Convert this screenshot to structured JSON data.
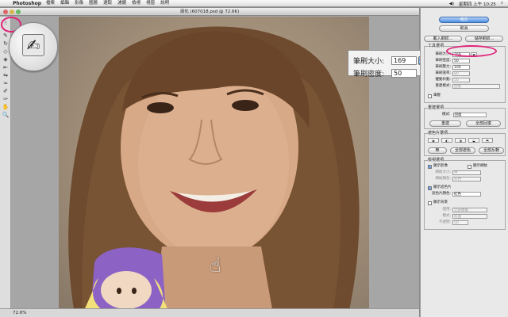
{
  "menubar": {
    "app": "Photoshop",
    "items": [
      "檔案",
      "編輯",
      "影像",
      "圖層",
      "選取",
      "濾鏡",
      "檢視",
      "視窗",
      "說明"
    ],
    "clock": "星期四 上午 10:25"
  },
  "document": {
    "title": "液化 (607018.psd @ 72.6K)",
    "zoom": "72.6%"
  },
  "hud": {
    "brush_size_label": "筆刷大小:",
    "brush_size_value": "169",
    "brush_density_label": "筆刷密度:",
    "brush_density_value": "50"
  },
  "panel": {
    "ok": "確定",
    "cancel": "取消",
    "load_mesh": "載入網紋...",
    "save_mesh": "儲存網紋...",
    "tool_options": {
      "title": "工具選項",
      "brush_size_label": "筆刷大小:",
      "brush_size": "169",
      "brush_density_label": "筆刷密度:",
      "brush_density": "50",
      "brush_pressure_label": "筆刷壓力:",
      "brush_pressure": "100",
      "brush_rate_label": "筆刷速率:",
      "brush_rate": "80",
      "turbulent_jitter_label": "擾動抖動:",
      "turbulent_jitter": "50",
      "reconstruct_mode_label": "重建模式:",
      "reconstruct_mode": "回復",
      "stylus_pressure": "筆壓"
    },
    "reconstruct": {
      "title": "重建選項",
      "mode_label": "模式:",
      "mode": "回復",
      "reconstruct_btn": "重建",
      "restore_all_btn": "全部回復"
    },
    "mask": {
      "title": "遮色片選項",
      "none_btn": "無",
      "mask_all_btn": "全部遮色",
      "invert_all_btn": "全部反轉"
    },
    "view": {
      "title": "檢視選項",
      "show_image": "顯示影像",
      "show_mesh": "顯示網紋",
      "mesh_size_label": "網紋大小:",
      "mesh_size": "中",
      "mesh_color_label": "網紋顏色:",
      "mesh_color": "灰色",
      "show_mask": "顯示遮色片",
      "mask_color_label": "遮色片顏色:",
      "mask_color": "紅色",
      "show_backdrop": "顯示背景",
      "use_label": "使用:",
      "use": "全部圖層",
      "backdrop_mode_label": "模式:",
      "backdrop_mode": "前面",
      "opacity_label": "不透明:",
      "opacity": "50"
    }
  }
}
